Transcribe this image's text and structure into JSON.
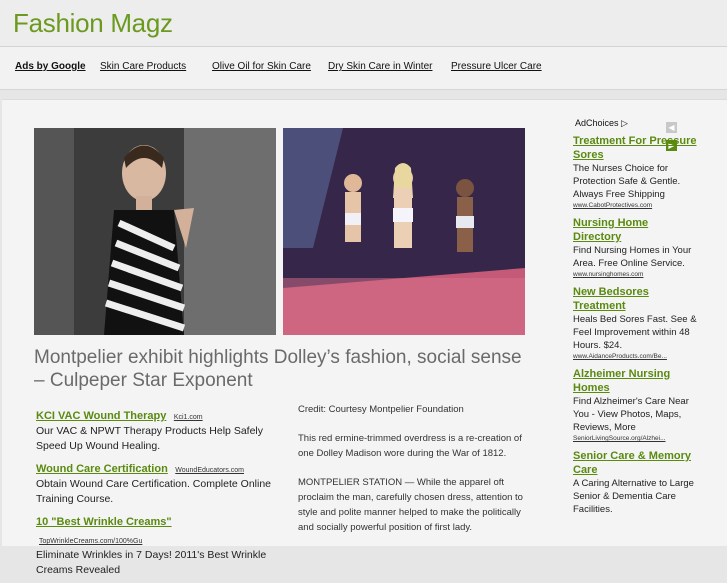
{
  "header": {
    "title": "Fashion Magz"
  },
  "adbar": {
    "ads_by": "Ads by Google",
    "links": [
      "Skin Care Products",
      "Olive Oil for Skin Care",
      "Dry Skin Care in Winter",
      "Pressure Ulcer Care"
    ]
  },
  "article": {
    "headline": "Montpelier exhibit highlights Dolley’s fashion, social sense – Culpeper Star Exponent",
    "paragraphs": [
      "Credit: Courtesy Montpelier Foundation",
      "This red ermine-trimmed overdress is a re-creation of one Dolley Madison wore during the War of 1812.",
      "MONTPELIER STATION — While the apparel oft proclaim the man, carefully chosen dress, attention to style and polite manner helped to make the politically and socially powerful position of first lady."
    ]
  },
  "left_ads": [
    {
      "title": "KCI VAC Wound Therapy",
      "url": "Kci1.com",
      "text": "Our VAC & NPWT Therapy Products Help Safely Speed Up Wound Healing."
    },
    {
      "title": "Wound Care Certification",
      "url": "WoundEducators.com",
      "text": "Obtain Wound Care Certification. Complete Online Training Course."
    },
    {
      "title": "10 \"Best Wrinkle Creams\"",
      "url": "TopWrinkleCreams.com/100%Gu",
      "text": "Eliminate Wrinkles in 7 Days! 2011's Best Wrinkle Creams Revealed"
    }
  ],
  "sidebar": {
    "adchoices": "AdChoices ▷",
    "ads": [
      {
        "title": "Treatment For Pressure Sores",
        "text": "The Nurses Choice for Protection Safe & Gentle. Always Free Shipping",
        "url": "www.CabotProtectives.com"
      },
      {
        "title": "Nursing Home Directory",
        "text": "Find Nursing Homes in Your Area. Free Online Service.",
        "url": "www.nursinghomes.com"
      },
      {
        "title": "New Bedsores Treatment",
        "text": "Heals Bed Sores Fast. See & Feel Improvement within 48 Hours. $24.",
        "url": "www.AidanceProducts.com/Be..."
      },
      {
        "title": "Alzheimer Nursing Homes",
        "text": "Find Alzheimer's Care Near You - View Photos, Maps, Reviews, More",
        "url": "SeniorLivingSource.org/Alzhei..."
      },
      {
        "title": "Senior Care & Memory Care",
        "text": "A Caring Alternative to Large Senior & Dementia Care Facilities.",
        "url": ""
      }
    ]
  },
  "colors": {
    "accent": "#6b9a1f",
    "link": "#5a8a10",
    "background": "#e6e6e6"
  }
}
